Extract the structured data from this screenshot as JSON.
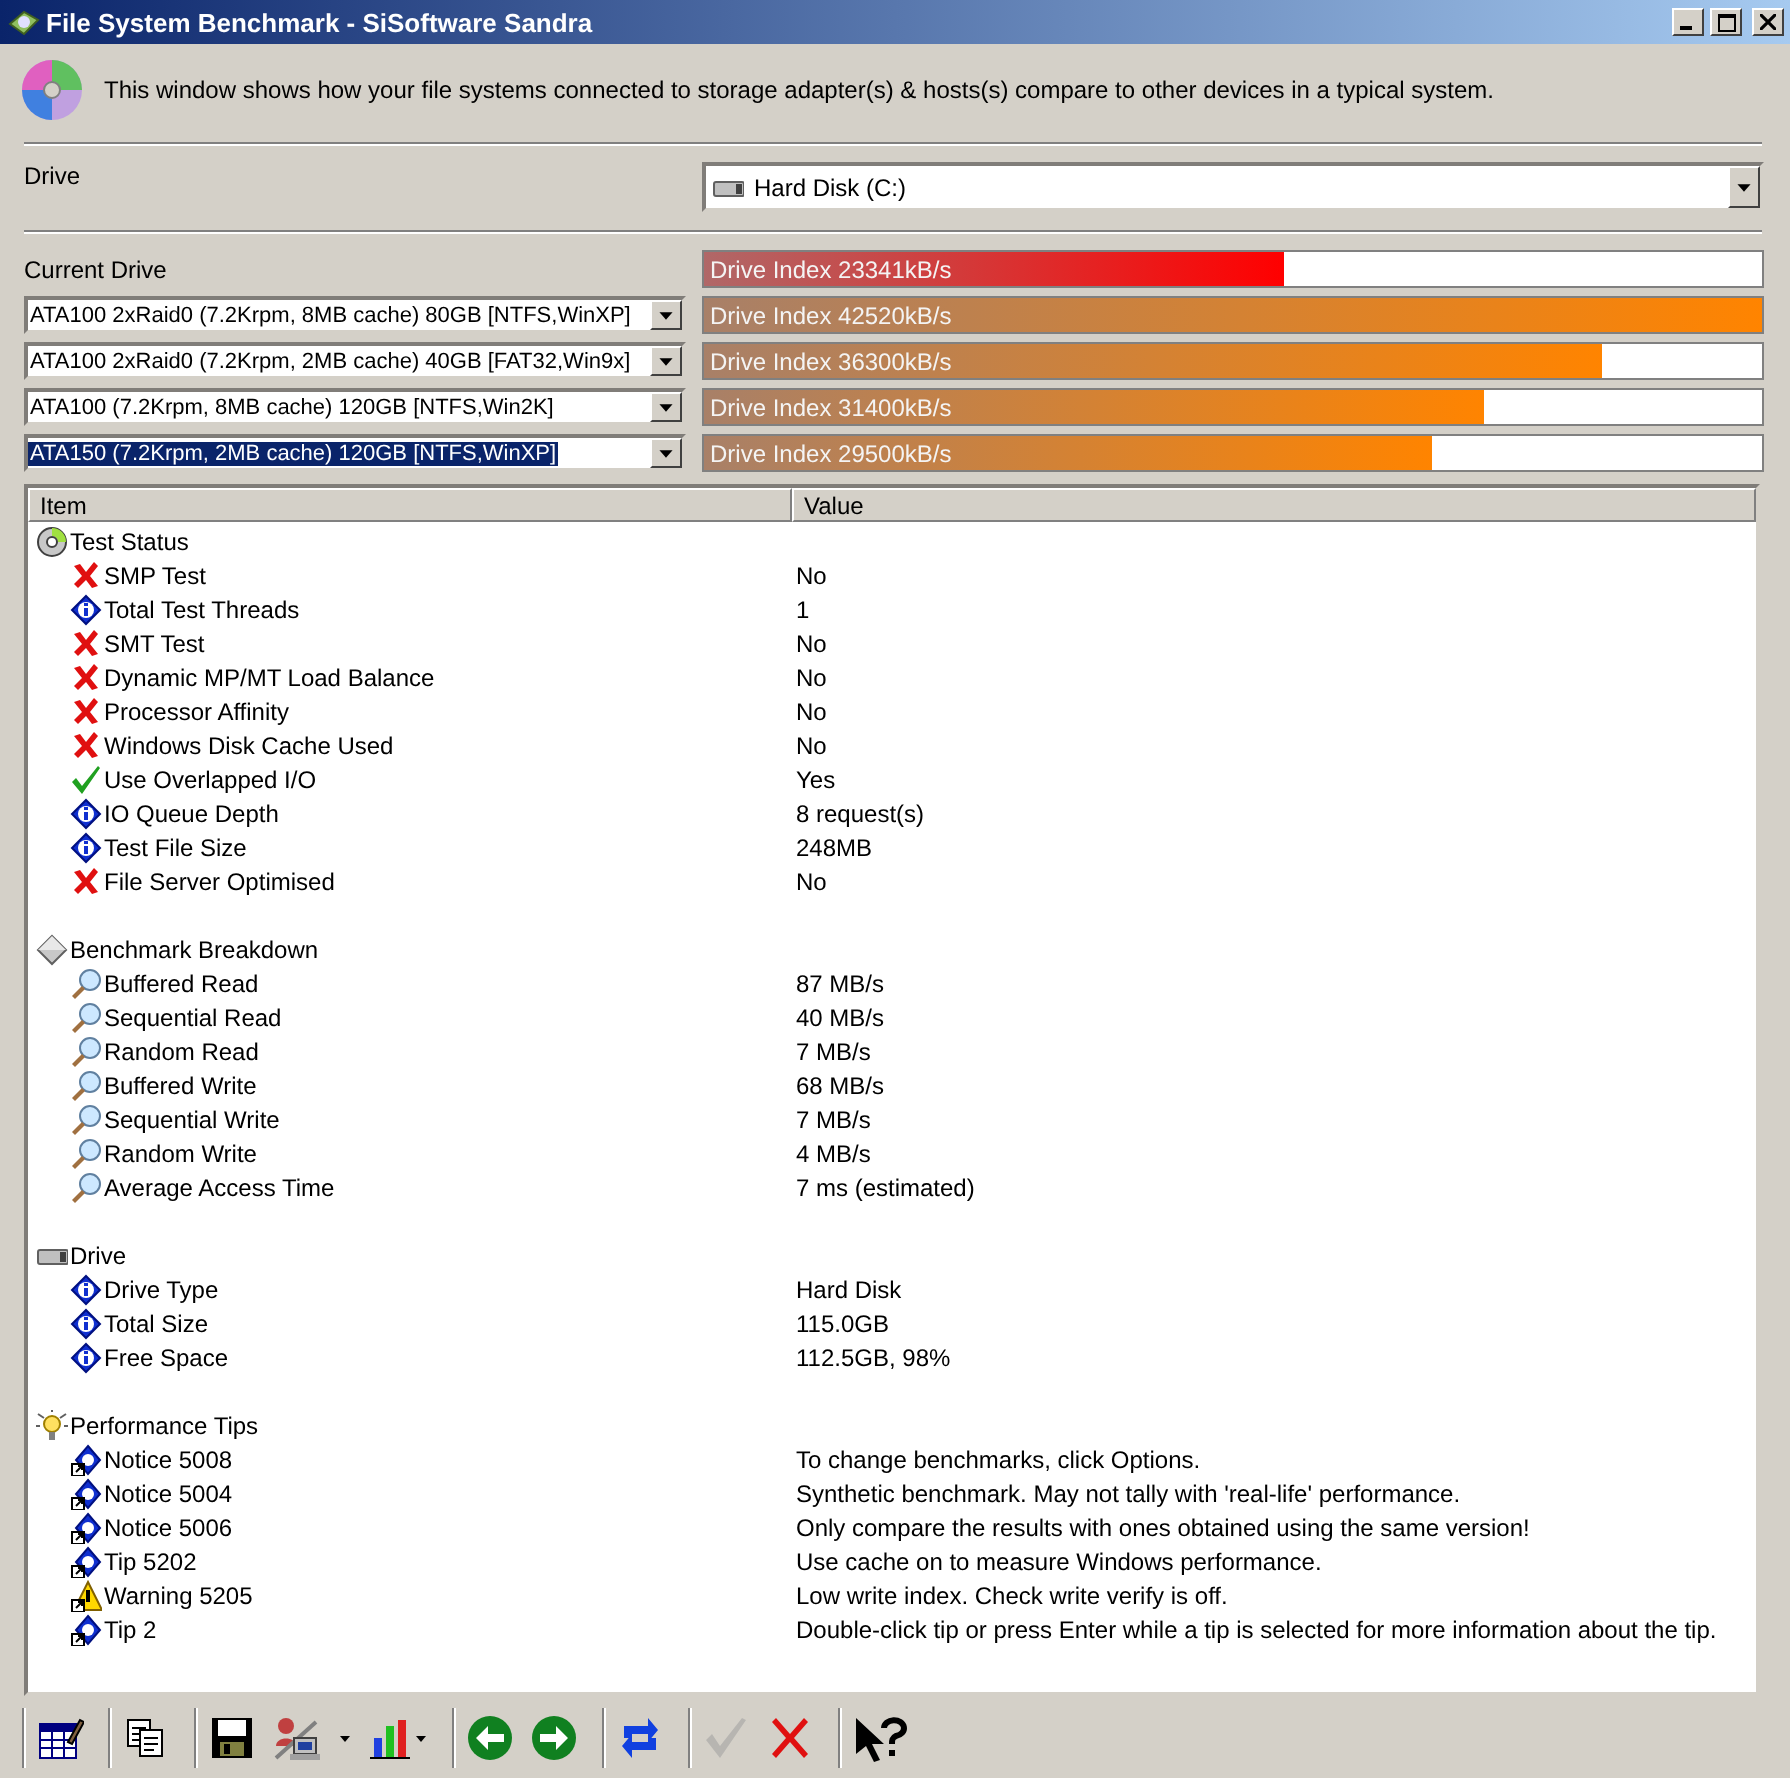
{
  "window": {
    "title": "File System Benchmark - SiSoftware Sandra"
  },
  "description": "This window shows how your file systems connected to storage adapter(s) & hosts(s) compare to other devices in a typical system.",
  "drive": {
    "label": "Drive",
    "value": "Hard Disk (C:)"
  },
  "current_drive": {
    "label": "Current Drive",
    "bar": {
      "text": "Drive Index 23341kB/s",
      "level": 0.549
    }
  },
  "comparisons": [
    {
      "value": "ATA100 2xRaid0 (7.2Krpm, 8MB cache) 80GB [NTFS,WinXP]",
      "selected": false,
      "bar": {
        "text": "Drive Index 42520kB/s",
        "level": 1.0
      }
    },
    {
      "value": "ATA100 2xRaid0 (7.2Krpm, 2MB cache) 40GB [FAT32,Win9x]",
      "selected": false,
      "bar": {
        "text": "Drive Index 36300kB/s",
        "level": 0.849
      }
    },
    {
      "value": "ATA100 (7.2Krpm, 8MB cache) 120GB [NTFS,Win2K]",
      "selected": false,
      "bar": {
        "text": "Drive Index 31400kB/s",
        "level": 0.738
      }
    },
    {
      "value": "ATA150 (7.2Krpm, 2MB cache) 120GB [NTFS,WinXP]",
      "selected": true,
      "bar": {
        "text": "Drive Index 29500kB/s",
        "level": 0.689
      }
    }
  ],
  "list": {
    "columns": [
      "Item",
      "Value"
    ],
    "groups": [
      {
        "title": "Test Status",
        "kind": "disc",
        "items": [
          {
            "label": "SMP Test",
            "value": "No",
            "kind": "cross"
          },
          {
            "label": "Total Test Threads",
            "value": "1",
            "kind": "info"
          },
          {
            "label": "SMT Test",
            "value": "No",
            "kind": "cross"
          },
          {
            "label": "Dynamic MP/MT Load Balance",
            "value": "No",
            "kind": "cross"
          },
          {
            "label": "Processor Affinity",
            "value": "No",
            "kind": "cross"
          },
          {
            "label": "Windows Disk Cache Used",
            "value": "No",
            "kind": "cross"
          },
          {
            "label": "Use Overlapped I/O",
            "value": "Yes",
            "kind": "check"
          },
          {
            "label": "IO Queue Depth",
            "value": "8 request(s)",
            "kind": "info"
          },
          {
            "label": "Test File Size",
            "value": "248MB",
            "kind": "info"
          },
          {
            "label": "File Server Optimised",
            "value": "No",
            "kind": "cross"
          }
        ]
      },
      {
        "title": "Benchmark Breakdown",
        "kind": "diamond",
        "items": [
          {
            "label": "Buffered Read",
            "value": "87 MB/s",
            "kind": "magnifier"
          },
          {
            "label": "Sequential Read",
            "value": "40 MB/s",
            "kind": "magnifier"
          },
          {
            "label": "Random Read",
            "value": "7 MB/s",
            "kind": "magnifier"
          },
          {
            "label": "Buffered Write",
            "value": "68 MB/s",
            "kind": "magnifier"
          },
          {
            "label": "Sequential Write",
            "value": "7 MB/s",
            "kind": "magnifier"
          },
          {
            "label": "Random Write",
            "value": "4 MB/s",
            "kind": "magnifier"
          },
          {
            "label": "Average Access Time",
            "value": "7 ms (estimated)",
            "kind": "magnifier"
          }
        ]
      },
      {
        "title": "Drive",
        "kind": "drive",
        "items": [
          {
            "label": "Drive Type",
            "value": "Hard Disk",
            "kind": "info"
          },
          {
            "label": "Total Size",
            "value": "115.0GB",
            "kind": "info"
          },
          {
            "label": "Free Space",
            "value": "112.5GB, 98%",
            "kind": "info"
          }
        ]
      },
      {
        "title": "Performance Tips",
        "kind": "bulb",
        "items": [
          {
            "label": "Notice 5008",
            "value": "To change benchmarks, click Options.",
            "kind": "tip"
          },
          {
            "label": "Notice 5004",
            "value": "Synthetic benchmark. May not tally with 'real-life' performance.",
            "kind": "tip"
          },
          {
            "label": "Notice 5006",
            "value": "Only compare the results with ones obtained using the same version!",
            "kind": "tip"
          },
          {
            "label": "Tip 5202",
            "value": "Use cache on to measure Windows performance.",
            "kind": "tip"
          },
          {
            "label": "Warning 5205",
            "value": "Low write index. Check write verify is off.",
            "kind": "warning"
          },
          {
            "label": "Tip 2",
            "value": "Double-click tip or press Enter while a tip is selected for more information about the tip.",
            "kind": "tip"
          }
        ]
      }
    ]
  },
  "toolbar": [
    [
      {
        "kind": "report",
        "dropdown": false,
        "disabled": false
      }
    ],
    [
      {
        "kind": "copy",
        "dropdown": false,
        "disabled": false
      }
    ],
    [
      {
        "kind": "save",
        "dropdown": false,
        "disabled": false
      },
      {
        "kind": "user",
        "dropdown": true,
        "disabled": false
      },
      {
        "kind": "chart",
        "dropdown": true,
        "disabled": false
      }
    ],
    [
      {
        "kind": "back",
        "dropdown": false,
        "disabled": false
      },
      {
        "kind": "forward",
        "dropdown": false,
        "disabled": false
      }
    ],
    [
      {
        "kind": "refresh",
        "dropdown": false,
        "disabled": false
      }
    ],
    [
      {
        "kind": "ok",
        "dropdown": false,
        "disabled": true
      },
      {
        "kind": "cancel",
        "dropdown": false,
        "disabled": false
      }
    ],
    [
      {
        "kind": "help",
        "dropdown": false,
        "disabled": false
      }
    ]
  ]
}
